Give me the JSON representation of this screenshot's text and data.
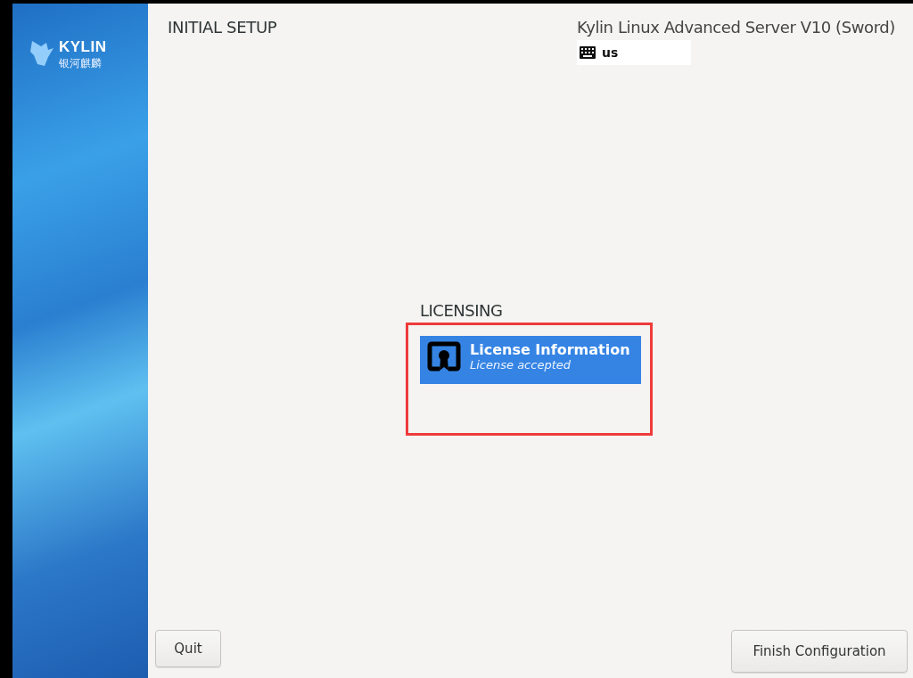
{
  "sidebar": {
    "logo_text": "KYLIN",
    "logo_subtext": "银河麒麟"
  },
  "header": {
    "title": "INITIAL SETUP",
    "product": "Kylin Linux Advanced Server V10 (Sword)",
    "keyboard_layout": "us"
  },
  "sections": [
    {
      "title": "LICENSING",
      "spokes": [
        {
          "title": "License Information",
          "status": "License accepted",
          "selected": true
        }
      ]
    }
  ],
  "buttons": [
    {
      "label": "Quit",
      "kind": "quit"
    },
    {
      "label": "Finish Configuration",
      "kind": "finish"
    }
  ]
}
